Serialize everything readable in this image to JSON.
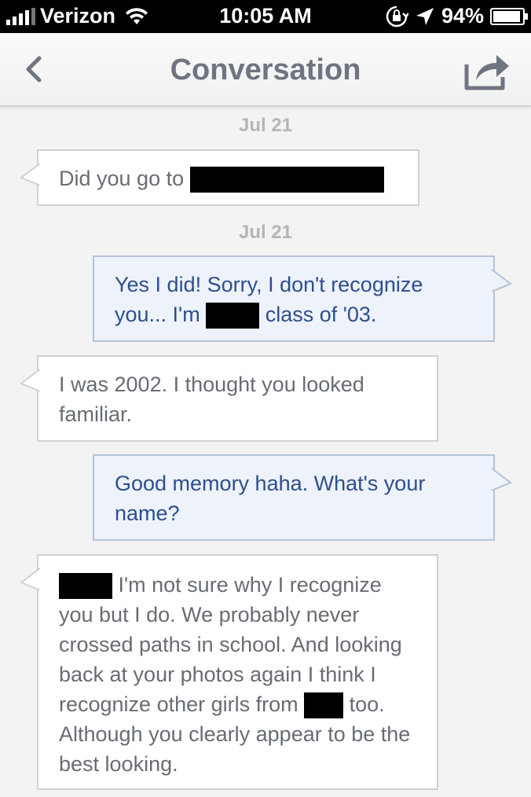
{
  "status_bar": {
    "carrier": "Verizon",
    "time": "10:05 AM",
    "battery": "94%",
    "battery_level": 0.94,
    "icons": [
      "signal-icon",
      "wifi-icon",
      "rotation-lock-icon",
      "location-arrow-icon",
      "battery-icon"
    ]
  },
  "nav": {
    "title": "Conversation",
    "back_icon": "chevron-left-icon",
    "share_icon": "share-icon"
  },
  "colors": {
    "incoming_text": "#686c73",
    "outgoing_text": "#2c4f8e",
    "outgoing_bg": "#eef2fb",
    "date_text": "#b3b5ba"
  },
  "messages": [
    {
      "type": "date",
      "text": "Jul 21"
    },
    {
      "type": "incoming",
      "parts": [
        "Did you go to ",
        "[redacted]"
      ]
    },
    {
      "type": "date",
      "text": "Jul 21"
    },
    {
      "type": "outgoing",
      "line1": "Yes I did! Sorry, I don't recognize",
      "line2_a": "you... I'm ",
      "line2_b": " class of '03."
    },
    {
      "type": "incoming",
      "text": "I was 2002. I thought you looked familiar."
    },
    {
      "type": "outgoing",
      "text": "Good memory haha. What's your name?"
    },
    {
      "type": "incoming",
      "a": " I'm not sure why I recognize you but I do. We probably never crossed paths in school. And looking back at your photos again I think I recognize other girls from ",
      "b": " too. Although you clearly appear to be the best looking."
    }
  ]
}
